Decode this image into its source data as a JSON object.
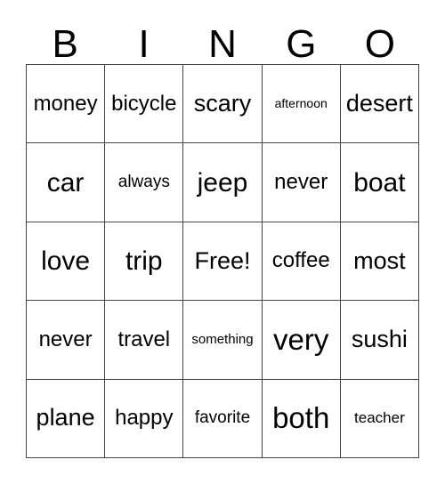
{
  "card": {
    "title": "BINGO",
    "free_space_label": "Free!",
    "border_color": "#444444",
    "text_color": "#000000",
    "background_color": "#ffffff"
  },
  "header": {
    "letters": [
      "B",
      "I",
      "N",
      "G",
      "O"
    ]
  },
  "grid": {
    "columns": 5,
    "rows": 5,
    "cells": [
      [
        {
          "text": "money",
          "size": "md"
        },
        {
          "text": "bicycle",
          "size": "md"
        },
        {
          "text": "scary",
          "size": "ml"
        },
        {
          "text": "afternoon",
          "size": "tiny"
        },
        {
          "text": "desert",
          "size": "ml"
        }
      ],
      [
        {
          "text": "car",
          "size": "lg"
        },
        {
          "text": "always",
          "size": "sm"
        },
        {
          "text": "jeep",
          "size": "lg"
        },
        {
          "text": "never",
          "size": "md"
        },
        {
          "text": "boat",
          "size": "lg"
        }
      ],
      [
        {
          "text": "love",
          "size": "lg"
        },
        {
          "text": "trip",
          "size": "lg"
        },
        {
          "text": "Free!",
          "size": "ml"
        },
        {
          "text": "coffee",
          "size": "md"
        },
        {
          "text": "most",
          "size": "ml"
        }
      ],
      [
        {
          "text": "never",
          "size": "md"
        },
        {
          "text": "travel",
          "size": "md"
        },
        {
          "text": "something",
          "size": "xxs"
        },
        {
          "text": "very",
          "size": "xl"
        },
        {
          "text": "sushi",
          "size": "ml"
        }
      ],
      [
        {
          "text": "plane",
          "size": "ml"
        },
        {
          "text": "happy",
          "size": "md"
        },
        {
          "text": "favorite",
          "size": "sm"
        },
        {
          "text": "both",
          "size": "xl"
        },
        {
          "text": "teacher",
          "size": "xs"
        }
      ]
    ]
  }
}
